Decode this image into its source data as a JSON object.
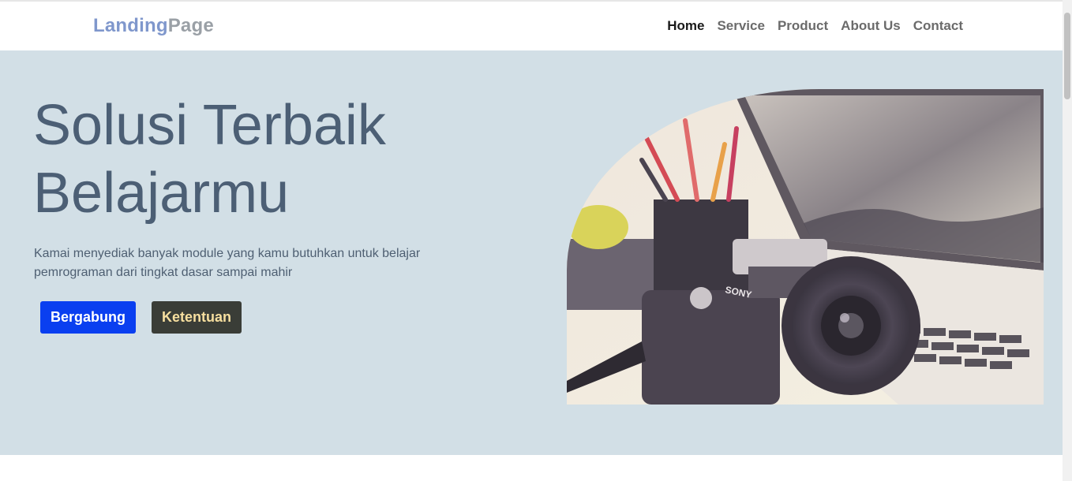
{
  "brand": {
    "part1": "Landing",
    "part2": "Page"
  },
  "nav": {
    "items": [
      {
        "label": "Home",
        "active": true
      },
      {
        "label": "Service",
        "active": false
      },
      {
        "label": "Product",
        "active": false
      },
      {
        "label": "About Us",
        "active": false
      },
      {
        "label": "Contact",
        "active": false
      }
    ]
  },
  "hero": {
    "title_line1": "Solusi Terbaik",
    "title_line2": "Belajarmu",
    "description_line1": "Kamai menyediak banyak module yang kamu butuhkan untuk belajar",
    "description_line2": "pemrograman dari tingkat dasar sampai mahir",
    "primary_button": "Bergabung",
    "secondary_button": "Ketentuan",
    "image_brand_text": "SONY"
  },
  "colors": {
    "hero_bg": "#d2dfe6",
    "title": "#4c5f75",
    "primary_button": "#0a3ff0",
    "secondary_button": "#3a3d37",
    "brand_accent": "#7f97cc"
  }
}
